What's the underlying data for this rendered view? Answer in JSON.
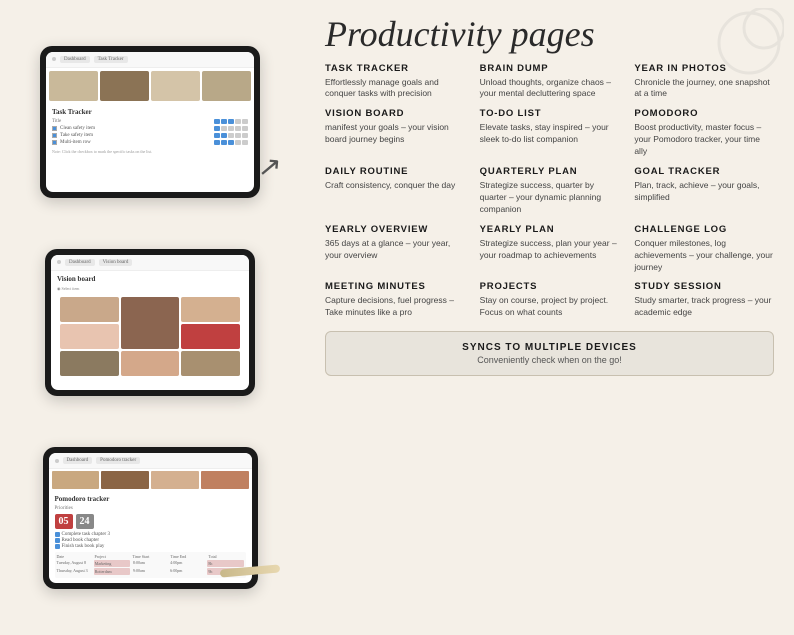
{
  "page": {
    "title": "Productivity pages",
    "background": "#f5f0e8"
  },
  "tablets": [
    {
      "name": "Task Tracker",
      "type": "large",
      "label": "task-tracker-tablet"
    },
    {
      "name": "Vision Board",
      "type": "medium",
      "label": "vision-board-tablet"
    },
    {
      "name": "Pomodoro Tracker",
      "type": "small",
      "label": "pomodoro-tablet"
    }
  ],
  "features": [
    {
      "title": "TASK TRACKER",
      "desc": "Effortlessly manage goals and conquer tasks with precision"
    },
    {
      "title": "BRAIN DUMP",
      "desc": "Unload thoughts, organize chaos – your mental decluttering space"
    },
    {
      "title": "YEAR IN PHOTOS",
      "desc": "Chronicle the journey, one snapshot at a time"
    },
    {
      "title": "VISION BOARD",
      "desc": "manifest your goals – your vision board journey begins"
    },
    {
      "title": "TO-DO LIST",
      "desc": "Elevate tasks, stay inspired – your sleek to-do list companion"
    },
    {
      "title": "POMODORO",
      "desc": "Boost productivity, master focus – your Pomodoro tracker, your time ally"
    },
    {
      "title": "DAILY ROUTINE",
      "desc": "Craft consistency, conquer the day"
    },
    {
      "title": "QUARTERLY PLAN",
      "desc": "Strategize success, quarter by quarter – your dynamic planning companion"
    },
    {
      "title": "GOAL TRACKER",
      "desc": "Plan, track, achieve – your goals, simplified"
    },
    {
      "title": "YEARLY OVERVIEW",
      "desc": "365 days at a glance – your year, your overview"
    },
    {
      "title": "YEARLY PLAN",
      "desc": "Strategize success, plan your year – your roadmap to achievements"
    },
    {
      "title": "CHALLENGE LOG",
      "desc": "Conquer milestones, log achievements – your challenge, your journey"
    },
    {
      "title": "MEETING MINUTES",
      "desc": "Capture decisions, fuel progress – Take minutes like a pro"
    },
    {
      "title": "PROJECTS",
      "desc": "Stay on course, project by project. Focus on what counts"
    },
    {
      "title": "STUDY SESSION",
      "desc": "Study smarter, track progress – your academic edge"
    }
  ],
  "sync": {
    "title": "SYNCS TO MULTIPLE DEVICES",
    "desc": "Conveniently check when on the go!"
  },
  "screen_labels": {
    "tab1a": "Dashboard",
    "tab1b": "Task Tracker",
    "title1": "Task Tracker",
    "tab2a": "Dashboard",
    "tab2b": "Vision board",
    "title2": "Vision board",
    "tab3a": "Dashboard",
    "tab3b": "Pomodoro tracker",
    "title3": "Pomodoro tracker",
    "pomo_label": "Priorities"
  }
}
